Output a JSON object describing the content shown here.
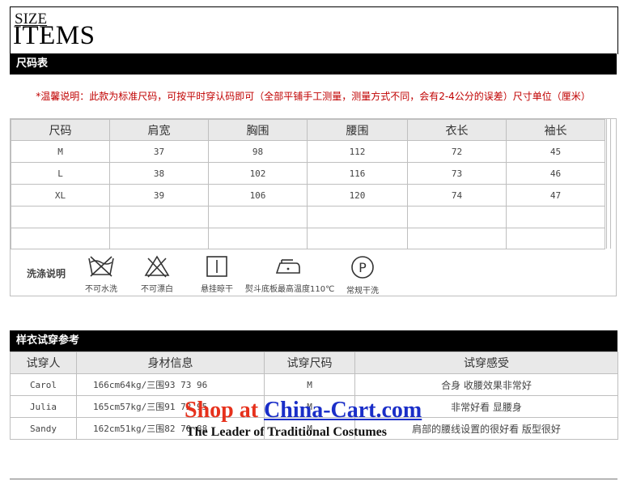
{
  "header": {
    "size_small": "SIZE",
    "size_big": "ITEMS"
  },
  "size_chart_bar": "尺码表",
  "note": "*温馨说明：此款为标准尺码，可按平时穿认码即可（全部平铺手工测量，测量方式不同，会有2-4公分的误差）尺寸单位（厘米）",
  "size_table": {
    "headers": [
      "尺码",
      "肩宽",
      "胸围",
      "腰围",
      "衣长",
      "袖长"
    ],
    "rows": [
      [
        "M",
        "37",
        "98",
        "112",
        "72",
        "45"
      ],
      [
        "L",
        "38",
        "102",
        "116",
        "73",
        "46"
      ],
      [
        "XL",
        "39",
        "106",
        "120",
        "74",
        "47"
      ]
    ]
  },
  "care": {
    "title": "洗涤说明",
    "items": [
      {
        "icon": "no-wash-icon",
        "label": "不可水洗"
      },
      {
        "icon": "no-bleach-icon",
        "label": "不可漂白"
      },
      {
        "icon": "hang-dry-icon",
        "label": "悬挂晾干"
      },
      {
        "icon": "iron-icon",
        "label": "熨斗底板最高温度110℃"
      },
      {
        "icon": "dry-clean-p-icon",
        "label": "常规干洗"
      }
    ]
  },
  "tryon_bar": "样衣试穿参考",
  "tryon_table": {
    "headers": [
      "试穿人",
      "身材信息",
      "试穿尺码",
      "试穿感受"
    ],
    "rows": [
      [
        "Carol",
        "166cm64kg/三围93 73 96",
        "M",
        "合身 收腰效果非常好"
      ],
      [
        "Julia",
        "165cm57kg/三围91 72 95",
        "M",
        "非常好看 显腰身"
      ],
      [
        "Sandy",
        "162cm51kg/三围82 70 88",
        "M",
        "肩部的腰线设置的很好看 版型很好"
      ]
    ]
  },
  "watermark": {
    "shop": "Shop",
    "at": "at",
    "site": "China-Cart.com",
    "tagline": "The Leader of Traditional Costumes"
  }
}
